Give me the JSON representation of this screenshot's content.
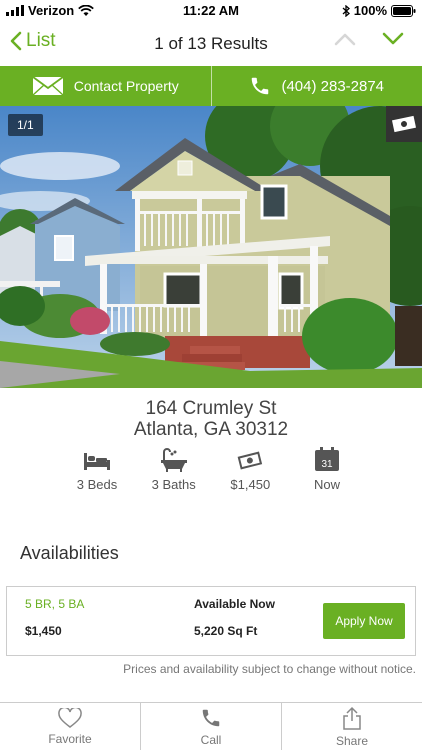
{
  "status_bar": {
    "carrier": "Verizon",
    "time": "11:22 AM",
    "battery": "100%"
  },
  "nav": {
    "back_label": "List",
    "title": "1 of 13 Results"
  },
  "actions": {
    "contact_label": "Contact Property",
    "phone_label": "(404) 283-2874"
  },
  "photo": {
    "counter": "1/1"
  },
  "address": {
    "street": "164 Crumley St",
    "city_state_zip": "Atlanta, GA 30312"
  },
  "facts": {
    "beds": "3 Beds",
    "baths": "3 Baths",
    "price": "$1,450",
    "availability": "Now",
    "calendar_day": "31"
  },
  "availabilities": {
    "title": "Availabilities",
    "unit": {
      "type": "5 BR, 5 BA",
      "price": "$1,450",
      "status": "Available Now",
      "sqft": "5,220 Sq Ft",
      "apply_label": "Apply Now"
    },
    "disclaimer": "Prices and availability subject to change without notice."
  },
  "tabs": {
    "favorite": "Favorite",
    "call": "Call",
    "share": "Share"
  },
  "colors": {
    "accent": "#6ab023"
  }
}
